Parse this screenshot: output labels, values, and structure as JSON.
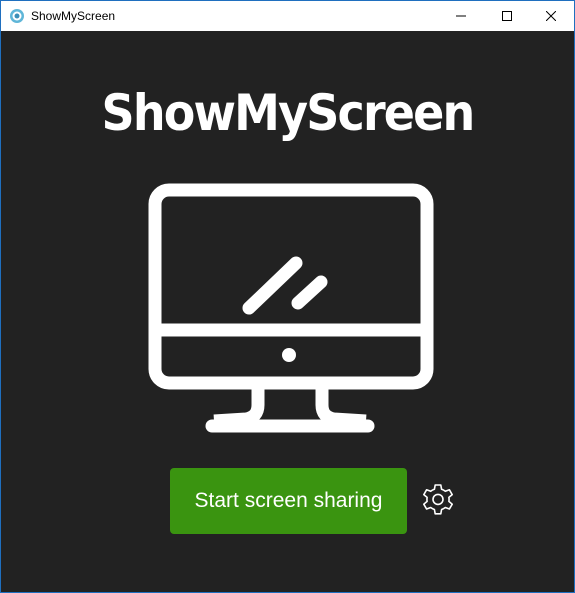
{
  "window": {
    "title": "ShowMyScreen",
    "controls": {
      "minimize_icon": "minimize-icon",
      "maximize_icon": "maximize-icon",
      "close_icon": "close-icon"
    }
  },
  "main": {
    "heading": "ShowMyScreen",
    "illustration_icon": "monitor-icon",
    "start_button_label": "Start screen sharing",
    "settings_icon": "gear-icon"
  },
  "colors": {
    "background": "#222222",
    "accent": "#3a9410",
    "text": "#ffffff",
    "window_border": "#1f6fbf"
  }
}
